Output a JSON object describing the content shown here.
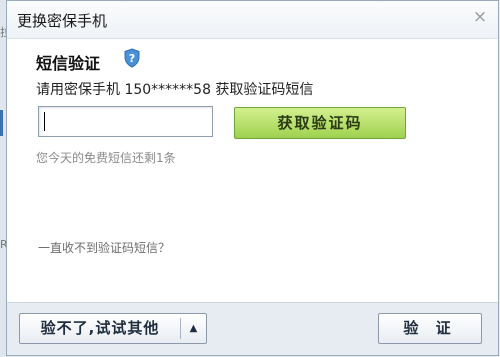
{
  "dialog": {
    "title": "更换密保手机",
    "close_glyph": "×"
  },
  "sms": {
    "section_title": "短信验证",
    "description": "请用密保手机 150******58 获取验证码短信",
    "input_value": "",
    "get_code_label": "获取验证码",
    "remaining_hint": "您今天的免费短信还剩1条",
    "no_code_link": "一直收不到验证码短信？"
  },
  "footer": {
    "alt_label": "验不了,试试其他",
    "alt_arrow_glyph": "▲",
    "verify_label": "验 证"
  },
  "icons": {
    "shield": "shield-question-icon",
    "close": "close-icon",
    "dropdown": "caret-up-icon"
  },
  "colors": {
    "accent_green": "#a6d658",
    "shield_blue": "#4a90d9",
    "footer_bg": "#e6ecf2"
  }
}
